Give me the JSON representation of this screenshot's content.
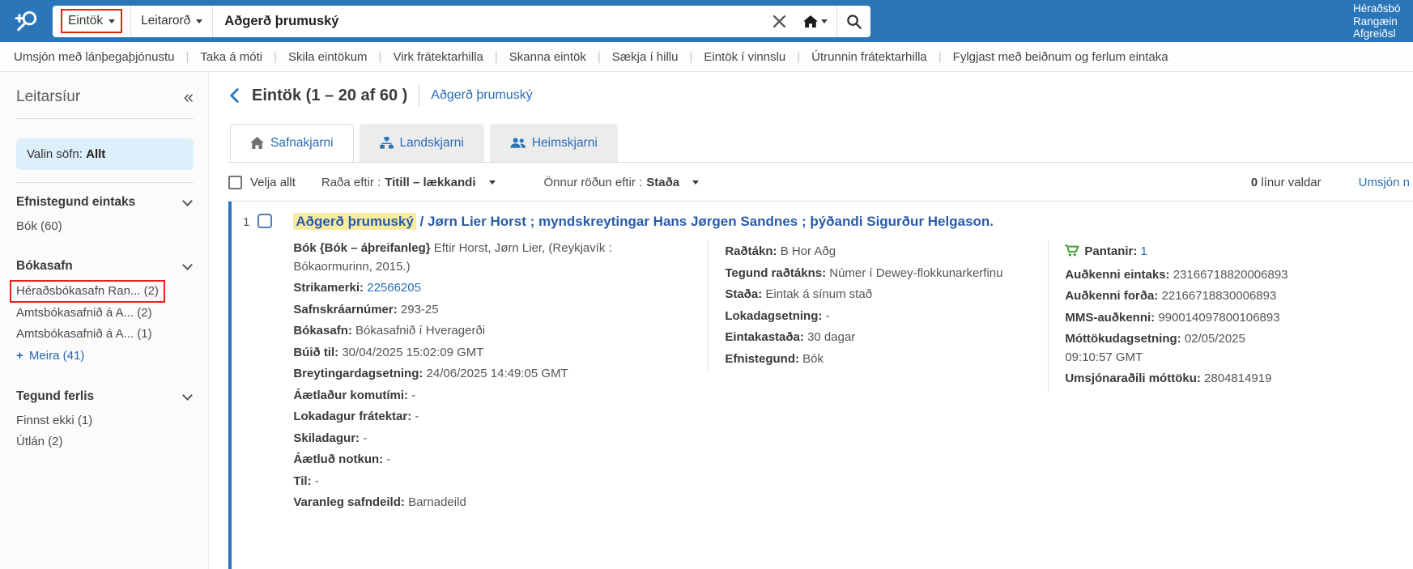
{
  "topbar": {
    "scope": "Eintök",
    "index": "Leitarorð",
    "search_value": "Aðgerð þrumuský",
    "org_lines": [
      "Héraðsbó",
      "Rangæin",
      "Afgreiðsl"
    ],
    "accent_blue": "#2a76b9",
    "highlight_red": "#e0251b"
  },
  "nav": {
    "items": [
      "Umsjón með lánþegaþjónustu",
      "Taka á móti",
      "Skila eintökum",
      "Virk frátektarhilla",
      "Skanna eintök",
      "Sækja í hillu",
      "Eintök í vinnslu",
      "Útrunnin frátektarhilla",
      "Fylgjast með beiðnum og ferlum eintaka"
    ]
  },
  "sidebar": {
    "title": "Leitarsíur",
    "collapse_icon": "«",
    "selected_label": "Valin söfn:",
    "selected_value": "Allt",
    "facets": [
      {
        "title": "Efnistegund eintaks",
        "items": [
          {
            "label": "Bók (60)"
          }
        ]
      },
      {
        "title": "Bókasafn",
        "items": [
          {
            "label": "Héraðsbókasafn Ran... (2)",
            "highlighted": true
          },
          {
            "label": "Amtsbókasafnið á A... (2)"
          },
          {
            "label": "Amtsbókasafnið á A... (1)"
          }
        ],
        "more": "Meira (41)"
      },
      {
        "title": "Tegund ferlis",
        "items": [
          {
            "label": "Finnst ekki (1)"
          },
          {
            "label": "Útlán (2)"
          }
        ]
      }
    ]
  },
  "main": {
    "title": "Eintök (1 – 20 af 60 )",
    "query_link": "Aðgerð þrumuský",
    "tabs": [
      {
        "label": "Safnakjarni",
        "icon": "house-icon",
        "active": true
      },
      {
        "label": "Landskjarni",
        "icon": "sitemap-icon",
        "active": false
      },
      {
        "label": "Heimskjarni",
        "icon": "users-icon",
        "active": false
      }
    ],
    "controls": {
      "select_all": "Velja allt",
      "sort_label": "Raða eftir :",
      "sort_value": "Titill – lækkandi",
      "sort2_label": "Önnur röðun eftir :",
      "sort2_value": "Staða",
      "selected_count": "0",
      "selected_text": " línur valdar",
      "manage_link": "Umsjón n"
    }
  },
  "result": {
    "index": "1",
    "title_highlighted": "Aðgerð þrumuský",
    "title_rest": " / Jørn Lier Horst ; myndskreytingar Hans Jørgen Sandnes ; þýðandi Sigurður Helgason.",
    "intro_bold": "Bók {Bók – áþreifanleg}",
    "intro_text": " Eftir Horst, Jørn Lier, (Reykjavík : Bókaormurinn, 2015.)",
    "columns": [
      {
        "fields": [
          {
            "label": "Strikamerki:",
            "value": "22566205",
            "link": true
          },
          {
            "label": "Safnskráarnúmer:",
            "value": "293-25"
          },
          {
            "label": "Bókasafn:",
            "value": "Bókasafnið í Hveragerði"
          },
          {
            "label": "Búið til:",
            "value": "30/04/2025 15:02:09 GMT"
          },
          {
            "label": "Breytingardagsetning:",
            "value": "24/06/2025 14:49:05 GMT"
          },
          {
            "label": "Áætlaður komutími:",
            "value": "-"
          },
          {
            "label": "Lokadagur frátektar:",
            "value": "-"
          },
          {
            "label": "Skiladagur:",
            "value": "-"
          },
          {
            "label": "Áætluð notkun:",
            "value": "-"
          },
          {
            "label": "Til:",
            "value": "-"
          },
          {
            "label": "Varanleg safndeild:",
            "value": "Barnadeild"
          }
        ]
      },
      {
        "fields": [
          {
            "label": "Raðtákn:",
            "value": "B Hor Aðg"
          },
          {
            "label": "Tegund raðtákns:",
            "value": "Númer í Dewey-flokkunarkerfinu"
          },
          {
            "label": "Staða:",
            "value": "Eintak á sínum stað"
          },
          {
            "label": "Lokadagsetning:",
            "value": "-"
          },
          {
            "label": "Eintakastaða:",
            "value": "30 dagar"
          },
          {
            "label": "Efnistegund:",
            "value": "Bók"
          }
        ]
      },
      {
        "fields": [
          {
            "label": "Pantanir:",
            "value": "1",
            "link": true,
            "icon": "cart"
          },
          {
            "label": "Auðkenni eintaks:",
            "value": "23166718820006893"
          },
          {
            "label": "Auðkenni forða:",
            "value": "22166718830006893"
          },
          {
            "label": "MMS-auðkenni:",
            "value": "990014097800106893"
          },
          {
            "label": "Móttökudagsetning:",
            "value": "02/05/2025 09:10:57 GMT"
          },
          {
            "label": "Umsjónaraðili móttöku:",
            "value": "2804814919"
          }
        ]
      }
    ]
  }
}
